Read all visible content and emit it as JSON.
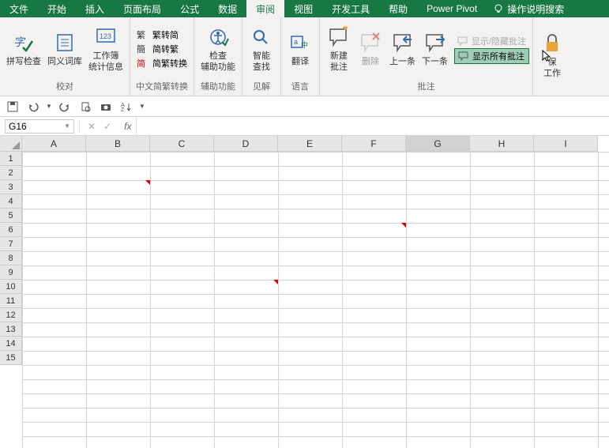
{
  "tabs": [
    "文件",
    "开始",
    "插入",
    "页面布局",
    "公式",
    "数据",
    "审阅",
    "视图",
    "开发工具",
    "帮助",
    "Power Pivot"
  ],
  "active_tab": 6,
  "tell_me": "操作说明搜索",
  "ribbon": {
    "proofing": {
      "spell": "拼写检查",
      "thesaurus": "同义词库",
      "stats": "工作簿\n统计信息",
      "group": "校对"
    },
    "chinese": {
      "s2t": "繁转简",
      "t2s": "简转繁",
      "conv": "简繁转换",
      "group": "中文简繁转换"
    },
    "acc": {
      "check": "检查\n辅助功能",
      "group": "辅助功能"
    },
    "insights": {
      "lookup": "智能\n查找",
      "group": "见解"
    },
    "lang": {
      "translate": "翻译",
      "group": "语言"
    },
    "comments": {
      "new": "新建\n批注",
      "del": "删除",
      "prev": "上一条",
      "next": "下一条",
      "showhide": "显示/隐藏批注",
      "showall": "显示所有批注",
      "group": "批注"
    },
    "protect": {
      "protect": "保\n工作"
    }
  },
  "namebox": "G16",
  "columns": [
    "A",
    "B",
    "C",
    "D",
    "E",
    "F",
    "G",
    "H",
    "I"
  ],
  "rows": [
    1,
    2,
    3,
    4,
    5,
    6,
    7,
    8,
    9,
    10,
    11,
    12,
    13,
    14,
    15
  ],
  "selected_col": 6,
  "comment_cells": [
    {
      "col": 1,
      "row": 2
    },
    {
      "col": 5,
      "row": 5
    },
    {
      "col": 3,
      "row": 9
    }
  ]
}
